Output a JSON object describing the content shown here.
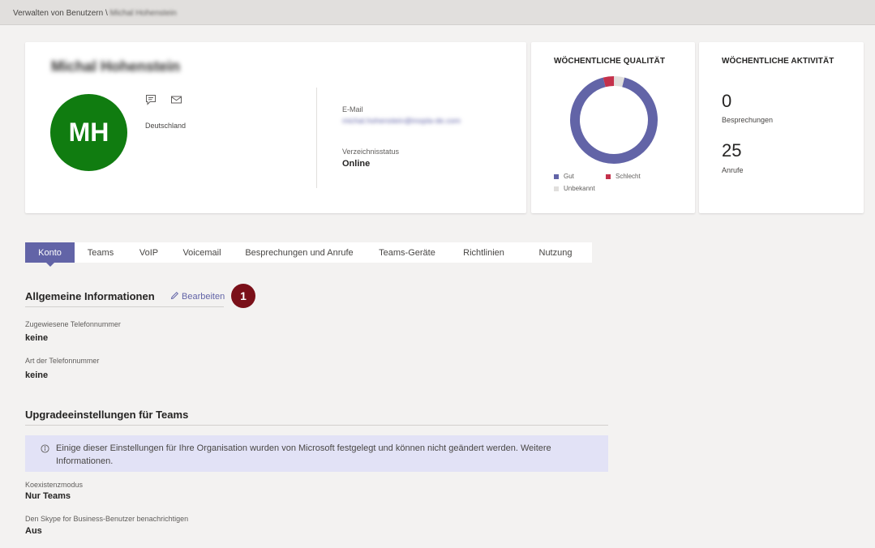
{
  "breadcrumb": {
    "parent": "Verwalten von Benutzern",
    "separator": "\\",
    "current": "Michal Hohenstein"
  },
  "profile": {
    "name": "Michal Hohenstein",
    "initials": "MH",
    "avatar_color": "#107c10",
    "country": "Deutschland",
    "icons": [
      "chat-icon",
      "mail-icon"
    ],
    "email_label": "E-Mail",
    "email_value": "michal.hohenstein@inopla-de.com",
    "directory_status_label": "Verzeichnisstatus",
    "directory_status_value": "Online"
  },
  "quality": {
    "title": "WÖCHENTLICHE QUALITÄT",
    "legend": {
      "good": "Gut",
      "bad": "Schlecht",
      "unknown": "Unbekannt"
    },
    "colors": {
      "good": "#6264a7",
      "bad": "#c4314b",
      "unknown": "#e1dfdd"
    }
  },
  "chart_data": {
    "type": "pie",
    "categories": [
      "Gut",
      "Schlecht",
      "Unbekannt"
    ],
    "values": [
      92,
      4,
      4
    ],
    "title": "WÖCHENTLICHE QUALITÄT",
    "legend_position": "bottom"
  },
  "activity": {
    "title": "WÖCHENTLICHE AKTIVITÄT",
    "meetings_count": "0",
    "meetings_label": "Besprechungen",
    "calls_count": "25",
    "calls_label": "Anrufe"
  },
  "tabs": [
    {
      "label": "Konto",
      "active": true
    },
    {
      "label": "Teams"
    },
    {
      "label": "VoIP"
    },
    {
      "label": "Voicemail"
    },
    {
      "label": "Besprechungen und Anrufe"
    },
    {
      "label": "Teams-Geräte"
    },
    {
      "label": "Richtlinien"
    },
    {
      "label": "Nutzung"
    }
  ],
  "general": {
    "title": "Allgemeine Informationen",
    "edit_label": "Bearbeiten",
    "badge": "1",
    "phone_label": "Zugewiesene Telefonnummer",
    "phone_value": "keine",
    "phone_type_label": "Art der Telefonnummer",
    "phone_type_value": "keine"
  },
  "upgrade": {
    "title": "Upgradeeinstellungen für Teams",
    "info_text": "Einige dieser Einstellungen für Ihre Organisation wurden von Microsoft festgelegt und können nicht geändert werden. Weitere Informationen.",
    "coexistence_label": "Koexistenzmodus",
    "coexistence_value": "Nur Teams",
    "notify_label": "Den Skype for Business-Benutzer benachrichtigen",
    "notify_value": "Aus"
  }
}
